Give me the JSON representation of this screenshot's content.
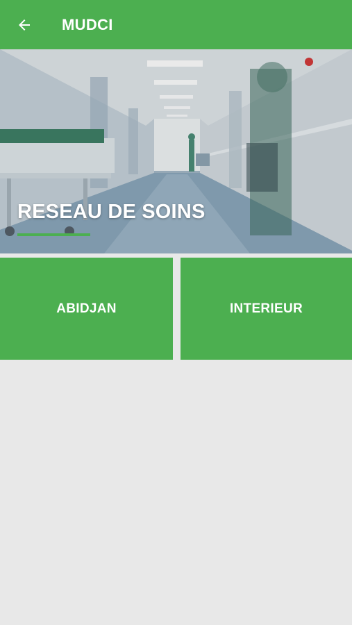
{
  "app_bar": {
    "title": "MUDCI",
    "back_icon": "arrow-left-icon",
    "background": "#4caf50"
  },
  "hero": {
    "title": "RESEAU DE SOINS",
    "accent": "#4caf50"
  },
  "regions": [
    {
      "label": "ABIDJAN"
    },
    {
      "label": "INTERIEUR"
    }
  ],
  "colors": {
    "primary": "#4caf50",
    "background": "#e8e8e8",
    "text_on_primary": "#ffffff"
  }
}
